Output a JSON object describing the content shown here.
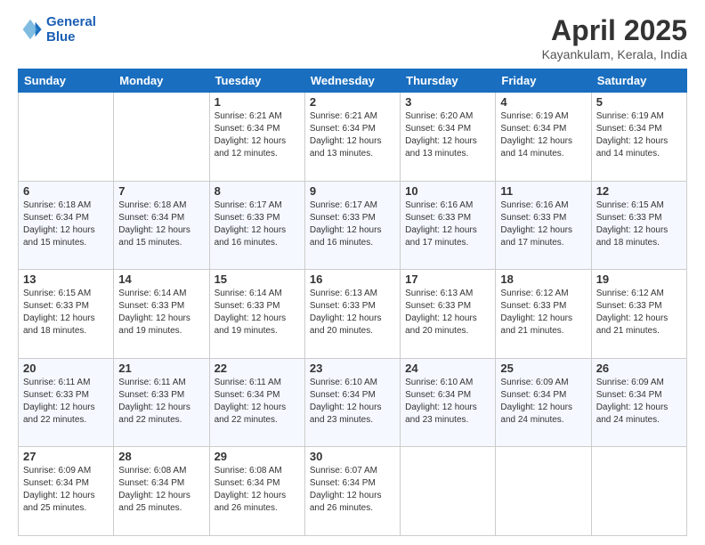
{
  "header": {
    "logo_line1": "General",
    "logo_line2": "Blue",
    "title": "April 2025",
    "location": "Kayankulam, Kerala, India"
  },
  "days_of_week": [
    "Sunday",
    "Monday",
    "Tuesday",
    "Wednesday",
    "Thursday",
    "Friday",
    "Saturday"
  ],
  "weeks": [
    [
      {
        "day": "",
        "info": ""
      },
      {
        "day": "",
        "info": ""
      },
      {
        "day": "1",
        "info": "Sunrise: 6:21 AM\nSunset: 6:34 PM\nDaylight: 12 hours and 12 minutes."
      },
      {
        "day": "2",
        "info": "Sunrise: 6:21 AM\nSunset: 6:34 PM\nDaylight: 12 hours and 13 minutes."
      },
      {
        "day": "3",
        "info": "Sunrise: 6:20 AM\nSunset: 6:34 PM\nDaylight: 12 hours and 13 minutes."
      },
      {
        "day": "4",
        "info": "Sunrise: 6:19 AM\nSunset: 6:34 PM\nDaylight: 12 hours and 14 minutes."
      },
      {
        "day": "5",
        "info": "Sunrise: 6:19 AM\nSunset: 6:34 PM\nDaylight: 12 hours and 14 minutes."
      }
    ],
    [
      {
        "day": "6",
        "info": "Sunrise: 6:18 AM\nSunset: 6:34 PM\nDaylight: 12 hours and 15 minutes."
      },
      {
        "day": "7",
        "info": "Sunrise: 6:18 AM\nSunset: 6:34 PM\nDaylight: 12 hours and 15 minutes."
      },
      {
        "day": "8",
        "info": "Sunrise: 6:17 AM\nSunset: 6:33 PM\nDaylight: 12 hours and 16 minutes."
      },
      {
        "day": "9",
        "info": "Sunrise: 6:17 AM\nSunset: 6:33 PM\nDaylight: 12 hours and 16 minutes."
      },
      {
        "day": "10",
        "info": "Sunrise: 6:16 AM\nSunset: 6:33 PM\nDaylight: 12 hours and 17 minutes."
      },
      {
        "day": "11",
        "info": "Sunrise: 6:16 AM\nSunset: 6:33 PM\nDaylight: 12 hours and 17 minutes."
      },
      {
        "day": "12",
        "info": "Sunrise: 6:15 AM\nSunset: 6:33 PM\nDaylight: 12 hours and 18 minutes."
      }
    ],
    [
      {
        "day": "13",
        "info": "Sunrise: 6:15 AM\nSunset: 6:33 PM\nDaylight: 12 hours and 18 minutes."
      },
      {
        "day": "14",
        "info": "Sunrise: 6:14 AM\nSunset: 6:33 PM\nDaylight: 12 hours and 19 minutes."
      },
      {
        "day": "15",
        "info": "Sunrise: 6:14 AM\nSunset: 6:33 PM\nDaylight: 12 hours and 19 minutes."
      },
      {
        "day": "16",
        "info": "Sunrise: 6:13 AM\nSunset: 6:33 PM\nDaylight: 12 hours and 20 minutes."
      },
      {
        "day": "17",
        "info": "Sunrise: 6:13 AM\nSunset: 6:33 PM\nDaylight: 12 hours and 20 minutes."
      },
      {
        "day": "18",
        "info": "Sunrise: 6:12 AM\nSunset: 6:33 PM\nDaylight: 12 hours and 21 minutes."
      },
      {
        "day": "19",
        "info": "Sunrise: 6:12 AM\nSunset: 6:33 PM\nDaylight: 12 hours and 21 minutes."
      }
    ],
    [
      {
        "day": "20",
        "info": "Sunrise: 6:11 AM\nSunset: 6:33 PM\nDaylight: 12 hours and 22 minutes."
      },
      {
        "day": "21",
        "info": "Sunrise: 6:11 AM\nSunset: 6:33 PM\nDaylight: 12 hours and 22 minutes."
      },
      {
        "day": "22",
        "info": "Sunrise: 6:11 AM\nSunset: 6:34 PM\nDaylight: 12 hours and 22 minutes."
      },
      {
        "day": "23",
        "info": "Sunrise: 6:10 AM\nSunset: 6:34 PM\nDaylight: 12 hours and 23 minutes."
      },
      {
        "day": "24",
        "info": "Sunrise: 6:10 AM\nSunset: 6:34 PM\nDaylight: 12 hours and 23 minutes."
      },
      {
        "day": "25",
        "info": "Sunrise: 6:09 AM\nSunset: 6:34 PM\nDaylight: 12 hours and 24 minutes."
      },
      {
        "day": "26",
        "info": "Sunrise: 6:09 AM\nSunset: 6:34 PM\nDaylight: 12 hours and 24 minutes."
      }
    ],
    [
      {
        "day": "27",
        "info": "Sunrise: 6:09 AM\nSunset: 6:34 PM\nDaylight: 12 hours and 25 minutes."
      },
      {
        "day": "28",
        "info": "Sunrise: 6:08 AM\nSunset: 6:34 PM\nDaylight: 12 hours and 25 minutes."
      },
      {
        "day": "29",
        "info": "Sunrise: 6:08 AM\nSunset: 6:34 PM\nDaylight: 12 hours and 26 minutes."
      },
      {
        "day": "30",
        "info": "Sunrise: 6:07 AM\nSunset: 6:34 PM\nDaylight: 12 hours and 26 minutes."
      },
      {
        "day": "",
        "info": ""
      },
      {
        "day": "",
        "info": ""
      },
      {
        "day": "",
        "info": ""
      }
    ]
  ]
}
